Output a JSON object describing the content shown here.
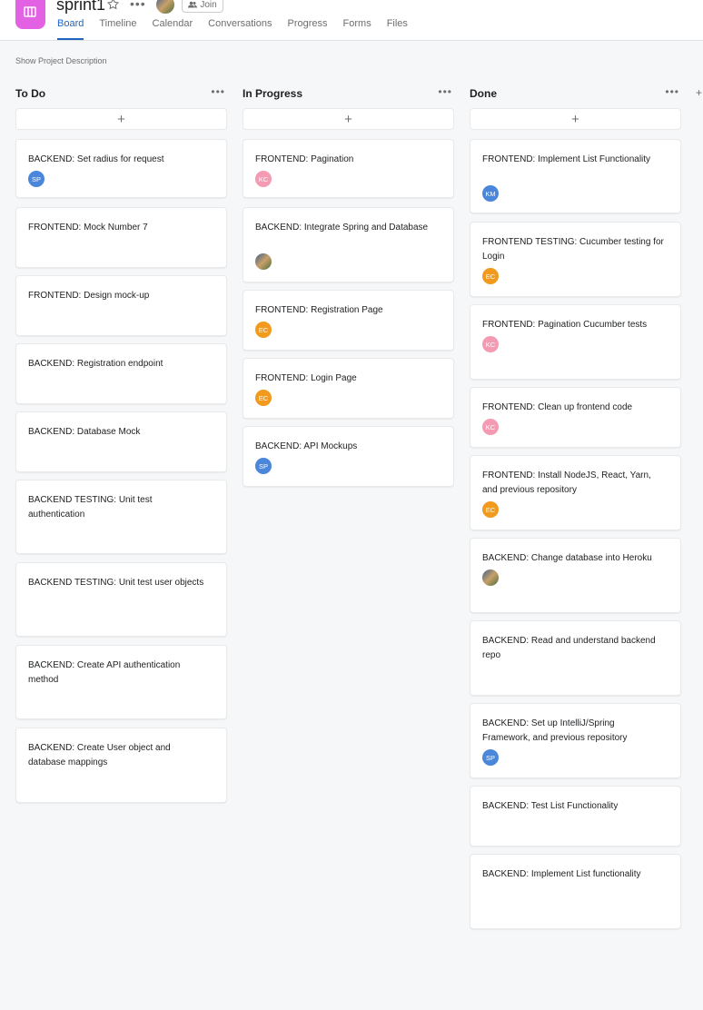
{
  "header": {
    "project_name": "sprint1",
    "join_label": "Join",
    "tabs": [
      "Board",
      "Timeline",
      "Calendar",
      "Conversations",
      "Progress",
      "Forms",
      "Files"
    ],
    "active_tab": "Board",
    "accent_color": "#1f64c2",
    "app_icon_color": "#e362e3"
  },
  "show_description_label": "Show Project Description",
  "columns": [
    {
      "title": "To Do",
      "cards": [
        {
          "title": "BACKEND: Set radius for request",
          "assignee": "SP"
        },
        {
          "title": "FRONTEND: Mock Number 7",
          "assignee": ""
        },
        {
          "title": "FRONTEND: Design mock-up",
          "assignee": ""
        },
        {
          "title": "BACKEND: Registration endpoint",
          "assignee": ""
        },
        {
          "title": "BACKEND: Database Mock",
          "assignee": ""
        },
        {
          "title": "BACKEND TESTING: Unit test authentication",
          "assignee": ""
        },
        {
          "title": "BACKEND TESTING: Unit test user objects",
          "assignee": ""
        },
        {
          "title": "BACKEND: Create API authentication method",
          "assignee": ""
        },
        {
          "title": "BACKEND: Create User object and database mappings",
          "assignee": ""
        }
      ]
    },
    {
      "title": "In Progress",
      "cards": [
        {
          "title": "FRONTEND: Pagination",
          "assignee": "KC"
        },
        {
          "title": "BACKEND: Integrate Spring and Database",
          "assignee": "photo"
        },
        {
          "title": "FRONTEND: Registration Page",
          "assignee": "EC"
        },
        {
          "title": "FRONTEND: Login Page",
          "assignee": "EC"
        },
        {
          "title": "BACKEND: API Mockups",
          "assignee": "SP"
        }
      ]
    },
    {
      "title": "Done",
      "cards": [
        {
          "title": "FRONTEND: Implement List Functionality",
          "assignee": "KM"
        },
        {
          "title": "FRONTEND TESTING: Cucumber testing for Login",
          "assignee": "EC"
        },
        {
          "title": "FRONTEND: Pagination Cucumber tests",
          "assignee": "KC"
        },
        {
          "title": "FRONTEND: Clean up frontend code",
          "assignee": "KC"
        },
        {
          "title": "FRONTEND: Install NodeJS, React, Yarn, and previous repository",
          "assignee": "EC"
        },
        {
          "title": "BACKEND: Change database into Heroku",
          "assignee": "photo"
        },
        {
          "title": "BACKEND: Read and understand backend repo",
          "assignee": ""
        },
        {
          "title": "BACKEND: Set up IntelliJ/Spring Framework, and previous repository",
          "assignee": "SP"
        },
        {
          "title": "BACKEND: Test List Functionality",
          "assignee": ""
        },
        {
          "title": "BACKEND: Implement List functionality",
          "assignee": ""
        }
      ]
    }
  ],
  "avatar_colors": {
    "SP": "#4a86d9",
    "KC": "#f49bb3",
    "EC": "#f19a1e",
    "KM": "#4a86d9"
  }
}
